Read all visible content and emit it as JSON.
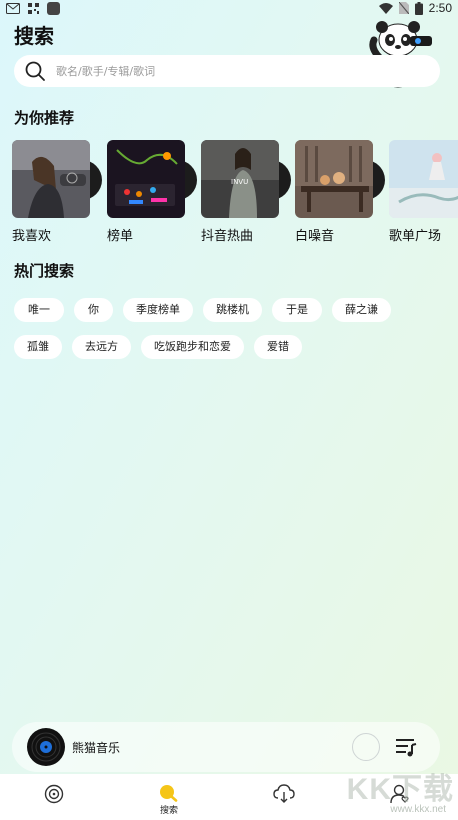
{
  "status_bar": {
    "time": "2:50"
  },
  "header": {
    "title": "搜索"
  },
  "search": {
    "placeholder": "歌名/歌手/专辑/歌词"
  },
  "recommend": {
    "title": "为你推荐",
    "items": [
      {
        "label": "我喜欢"
      },
      {
        "label": "榜单"
      },
      {
        "label": "抖音热曲"
      },
      {
        "label": "白噪音"
      },
      {
        "label": "歌单广场"
      }
    ],
    "cover3_text": "INVU"
  },
  "hot_search": {
    "title": "热门搜索",
    "row1": [
      "唯一",
      "你",
      "季度榜单",
      "跳楼机",
      "于是",
      "薛之谦"
    ],
    "row2": [
      "孤雏",
      "去远方",
      "吃饭跑步和恋爱",
      "爱错"
    ]
  },
  "player": {
    "song_name": "熊猫音乐"
  },
  "tabbar": {
    "tabs": [
      {
        "icon": "disc-icon",
        "label": ""
      },
      {
        "icon": "search-icon",
        "label": "搜索"
      },
      {
        "icon": "cloud-download-icon",
        "label": ""
      },
      {
        "icon": "profile-heart-icon",
        "label": ""
      }
    ],
    "active_color": "#f5c518"
  },
  "watermark": {
    "text": "KK下载",
    "url": "www.kkx.net"
  }
}
